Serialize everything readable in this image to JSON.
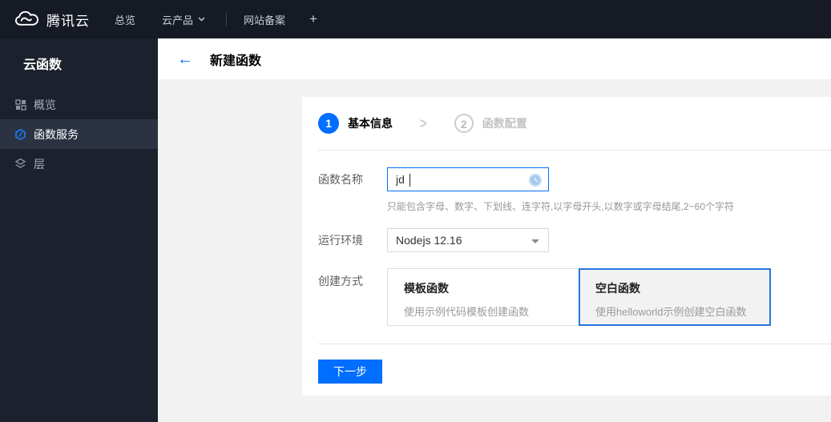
{
  "topbar": {
    "brand": "腾讯云",
    "overview": "总览",
    "products": "云产品",
    "icp": "网站备案",
    "plus": "+"
  },
  "sidebar": {
    "title": "云函数",
    "items": [
      {
        "label": "概览",
        "icon": "grid-icon",
        "active": false
      },
      {
        "label": "函数服务",
        "icon": "function-icon",
        "active": true
      },
      {
        "label": "层",
        "icon": "layers-icon",
        "active": false
      }
    ]
  },
  "page": {
    "back": "←",
    "title": "新建函数"
  },
  "wizard": {
    "steps": [
      {
        "num": "1",
        "label": "基本信息",
        "active": true
      },
      {
        "num": "2",
        "label": "函数配置",
        "active": false
      }
    ]
  },
  "form": {
    "name": {
      "label": "函数名称",
      "value": "jd",
      "helper": "只能包含字母、数字、下划线、连字符,以字母开头,以数字或字母结尾,2~60个字符"
    },
    "runtime": {
      "label": "运行环境",
      "value": "Nodejs 12.16"
    },
    "method": {
      "label": "创建方式",
      "options": [
        {
          "title": "模板函数",
          "desc": "使用示例代码模板创建函数",
          "selected": false
        },
        {
          "title": "空白函数",
          "desc": "使用helloworld示例创建空白函数",
          "selected": true
        }
      ]
    }
  },
  "footer": {
    "next": "下一步"
  },
  "colors": {
    "accent": "#006eff",
    "topbar_bg": "#151a24",
    "sidebar_bg": "#1c222d",
    "sidebar_active_bg": "#2b3342",
    "content_bg": "#f2f2f2",
    "selected_card_border": "#2577e3",
    "idle_step": "#cccccc"
  }
}
